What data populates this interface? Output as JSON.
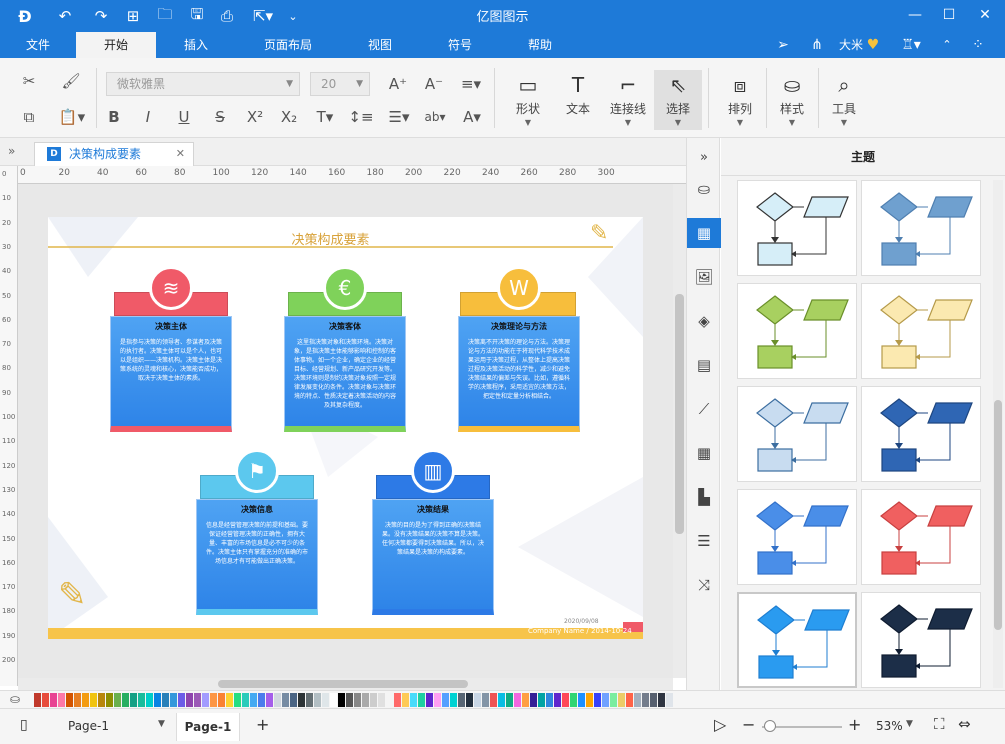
{
  "app": {
    "title": "亿图图示"
  },
  "menu": {
    "tabs": [
      "文件",
      "开始",
      "插入",
      "页面布局",
      "视图",
      "符号",
      "帮助"
    ],
    "active_tab": "开始",
    "user": "大米"
  },
  "ribbon": {
    "font_family": "微软雅黑",
    "font_size": "20",
    "tools": {
      "shape": "形状",
      "text": "文本",
      "connector": "连接线",
      "select": "选择",
      "arrange": "排列",
      "style": "样式",
      "tools": "工具"
    }
  },
  "document": {
    "tab_title": "决策构成要素"
  },
  "ruler": {
    "h_ticks": [
      "0",
      "20",
      "40",
      "60",
      "80",
      "100",
      "120",
      "140",
      "160",
      "180",
      "200",
      "220",
      "240",
      "260",
      "280",
      "300"
    ],
    "v_ticks": [
      "0",
      "10",
      "20",
      "30",
      "40",
      "50",
      "60",
      "70",
      "80",
      "90",
      "100",
      "110",
      "120",
      "130",
      "140",
      "150",
      "160",
      "170",
      "180",
      "190",
      "200"
    ]
  },
  "diagram": {
    "title": "决策构成要素",
    "cards": [
      {
        "title": "决策主体",
        "body": "是指参与决策的领导者、参谋者及决策的执行者。决策主体可以是个人，也可以是组织——决策机构。决策主体是决策系统的灵魂和核心，决策能否成功，取决于决策主体的素质。",
        "band_color": "#f05a68",
        "icon": "wifi-icon",
        "glyph": "≋"
      },
      {
        "title": "决策客体",
        "body": "这里指决策对象和决策环境。决策对象，是指决策主体能够影响和控制的客体事物。如一个企业，确定企业的经营目标、经营规划、新产品研究开发等。决策环境则是制约决策对象按照一定规律发展变化的条件。决策对象与决策环境的特点、性质决定着决策活动的内容及其复杂程度。",
        "band_color": "#7fd25a",
        "icon": "euro-icon",
        "glyph": "€"
      },
      {
        "title": "决策理论与方法",
        "body": "决策离不开决策的理论与方法。决策理论与方法的功能在于将现代科学技术成果运用于决策过程，从整体上提高决策过程及决策活动的科学性，减少和避免决策结果的偏差与失误。比如，遵循科学的决策程序，采用适宜的决策方法，把定性和定量分析相结合。",
        "band_color": "#f7be3c",
        "icon": "wordpress-icon",
        "glyph": "W"
      },
      {
        "title": "决策信息",
        "body": "信息是经营管理决策的前提和基础。要保证经营管理决策的正确性，拥有大量、丰富的市场信息是必不可少的条件。决策主体只有掌握充分的准确的市场信息才有可能做出正确决策。",
        "band_color": "#5cc8ee",
        "icon": "flag-icon",
        "glyph": "⚑"
      },
      {
        "title": "决策结果",
        "body": "决策的目的是为了得到正确的决策结果。没有决策结果的决策不算是决策。任何决策都要得到决策结果。所以，决策结果是决策的构成要素。",
        "band_color": "#2d7ae6",
        "icon": "bar-chart-icon",
        "glyph": "▥"
      }
    ],
    "footer": "Company Name / 2014-10-24",
    "footer_date": "2020/09/08"
  },
  "panel": {
    "title": "主题"
  },
  "themes": [
    {
      "shape": "#d6eef8",
      "line": "#333"
    },
    {
      "shape": "#6fa0cf",
      "line": "#4f7fb0"
    },
    {
      "shape": "#a8d060",
      "line": "#6a8f2a"
    },
    {
      "shape": "#fbe9b0",
      "line": "#b59a4a"
    },
    {
      "shape": "#c8dcf0",
      "line": "#3c6ea0"
    },
    {
      "shape": "#2f66b4",
      "line": "#1e4680"
    },
    {
      "shape": "#4a8ee8",
      "line": "#3371c9"
    },
    {
      "shape": "#f06060",
      "line": "#c84040"
    },
    {
      "shape": "#2a9bf0",
      "line": "#1f7ed0"
    },
    {
      "shape": "#1c2e48",
      "line": "#0f1c30"
    }
  ],
  "palette": [
    "#c0392b",
    "#e74c3c",
    "#e84393",
    "#fd79a8",
    "#d35400",
    "#e67e22",
    "#f39c12",
    "#f1c40f",
    "#b8860b",
    "#8e8e00",
    "#6ab04c",
    "#27ae60",
    "#16a085",
    "#1abc9c",
    "#00cec9",
    "#0984e3",
    "#2980b9",
    "#3498db",
    "#6c5ce7",
    "#8e44ad",
    "#9b59b6",
    "#a29bfe",
    "#fd9644",
    "#fa8231",
    "#fed330",
    "#26de81",
    "#2bcbba",
    "#45aaf2",
    "#4b7bec",
    "#a55eea",
    "#d1d8e0",
    "#778ca3",
    "#4b6584",
    "#2d3436",
    "#636e72",
    "#b2bec3",
    "#dfe6e9",
    "#ffffff",
    "#000000",
    "#555555",
    "#888888",
    "#aaaaaa",
    "#cccccc",
    "#e0e0e0",
    "#f5f5f5",
    "#ff6b6b",
    "#feca57",
    "#48dbfb",
    "#1dd1a1",
    "#5f27cd",
    "#ff9ff3",
    "#54a0ff",
    "#00d2d3",
    "#576574",
    "#222f3e",
    "#c8d6e5",
    "#8395a7",
    "#ee5253",
    "#0abde3",
    "#10ac84",
    "#f368e0",
    "#ff9f43",
    "#341f97",
    "#01a3a4",
    "#2e86de",
    "#5f27cd",
    "#ff4757",
    "#2ed573",
    "#1e90ff",
    "#ffa502",
    "#3742fa",
    "#70a1ff",
    "#7bed9f",
    "#eccc68",
    "#ff6348",
    "#a4b0be",
    "#747d8c",
    "#57606f",
    "#2f3542",
    "#dfe4ea"
  ],
  "status": {
    "page_tab": "Page-1",
    "page_active": "Page-1",
    "zoom": "53%"
  }
}
